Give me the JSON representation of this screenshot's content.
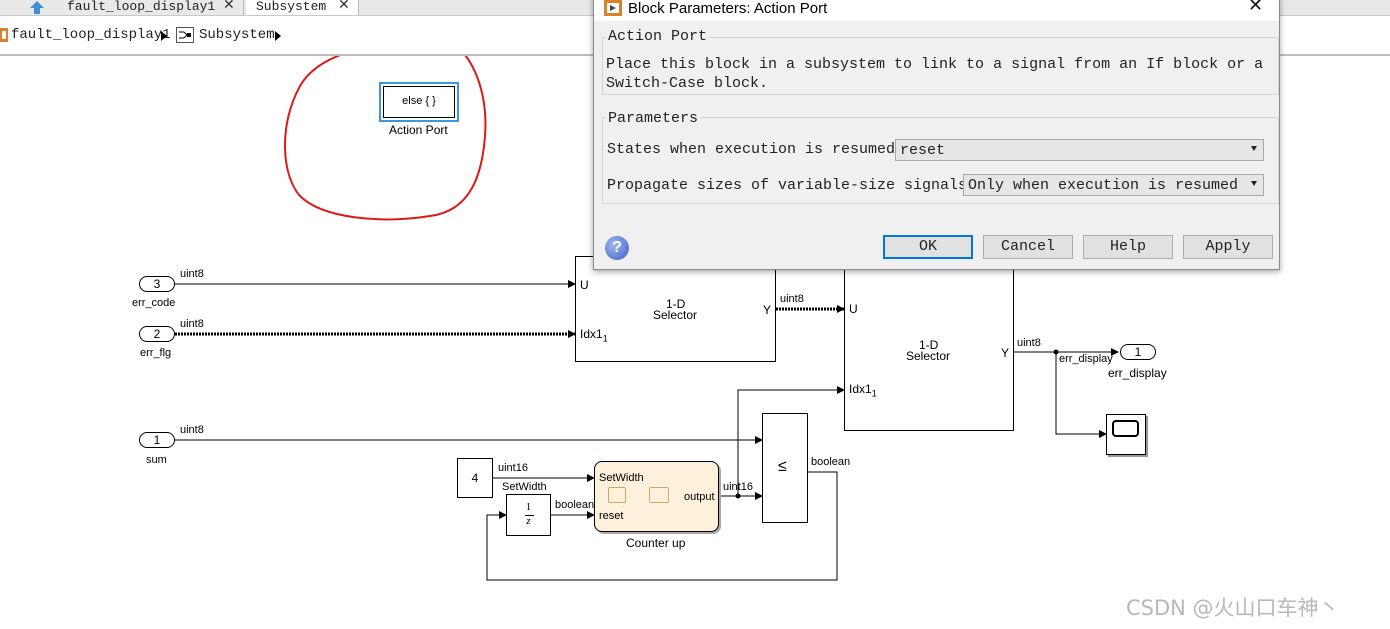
{
  "tabs": [
    {
      "label": "fault_loop_display1"
    },
    {
      "label": "Subsystem"
    }
  ],
  "breadcrumb": [
    "fault_loop_display1",
    "Subsystem"
  ],
  "dialog": {
    "title": "Block Parameters: Action Port",
    "section_title": "Action Port",
    "description_line1": "Place this block in a subsystem to link to a signal from an If block or a",
    "description_line2": "Switch-Case block.",
    "params_title": "Parameters",
    "states_label": "States when execution is resumed:",
    "states_value": "reset",
    "propagate_label": "Propagate sizes of variable-size signals:",
    "propagate_value": "Only when execution is resumed",
    "buttons": {
      "ok": "OK",
      "cancel": "Cancel",
      "help": "Help",
      "apply": "Apply"
    }
  },
  "model": {
    "action_port": {
      "text": "else { }",
      "label": "Action Port"
    },
    "inports": [
      {
        "num": "3",
        "name": "err_code"
      },
      {
        "num": "2",
        "name": "err_flg"
      },
      {
        "num": "1",
        "name": "sum"
      }
    ],
    "selector1": {
      "line1": "1-D",
      "line2": "Selector",
      "u": "U",
      "idx": "Idx1",
      "sub": "1",
      "y": "Y"
    },
    "selector2": {
      "line1": "1-D",
      "line2": "Selector",
      "u": "U",
      "idx": "Idx1",
      "sub": "1",
      "y": "Y"
    },
    "signal_labels": {
      "uint8_a": "uint8",
      "uint8_b": "uint8",
      "uint8_c": "uint8",
      "uint8_d": "uint8",
      "uint8_e": "uint8",
      "uint16_a": "uint16",
      "uint16_b": "uint16",
      "boolean_a": "boolean",
      "boolean_b": "boolean",
      "setwidth": "SetWidth",
      "err_display_sig": "err_display"
    },
    "outport": {
      "num": "1",
      "name": "err_display"
    },
    "constant": {
      "value": "4"
    },
    "delay": {
      "num": "1",
      "den": "z"
    },
    "chart": {
      "setwidth": "SetWidth",
      "reset": "reset",
      "output": "output",
      "label": "Counter up"
    },
    "relop": {
      "symbol": "≤"
    }
  },
  "watermark": "CSDN @火山口车神丶"
}
